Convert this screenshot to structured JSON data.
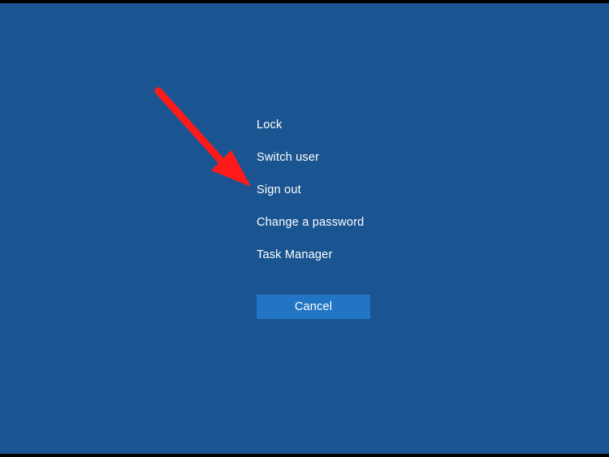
{
  "security_menu": {
    "items": [
      {
        "label": "Lock"
      },
      {
        "label": "Switch user"
      },
      {
        "label": "Sign out"
      },
      {
        "label": "Change a password"
      },
      {
        "label": "Task Manager"
      }
    ],
    "cancel_label": "Cancel"
  },
  "annotation": {
    "arrow_color": "#ff1a1a",
    "arrow_target": "Sign out"
  }
}
